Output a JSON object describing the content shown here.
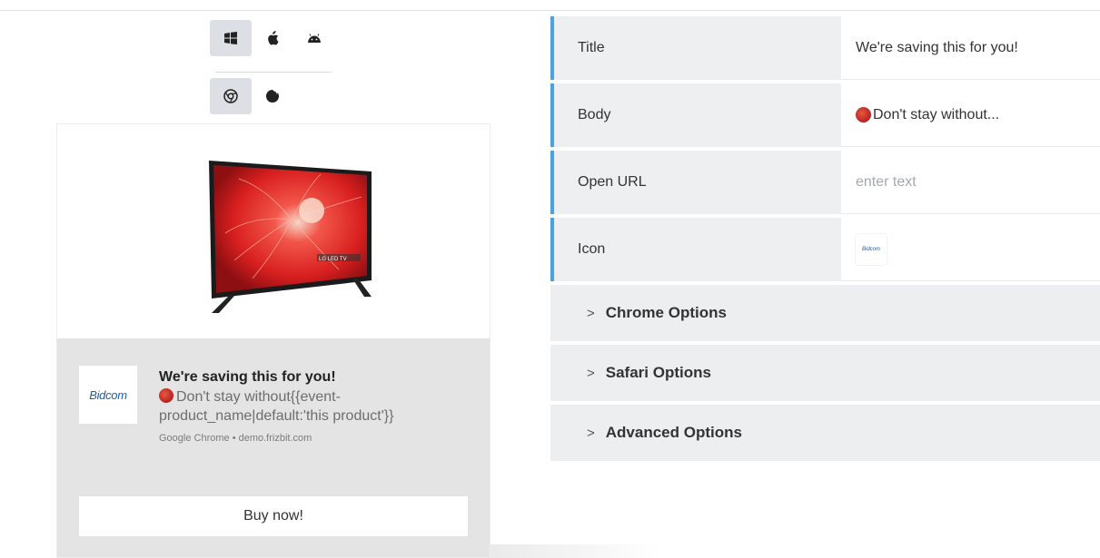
{
  "platforms": {
    "os": [
      {
        "name": "windows-icon",
        "active": true
      },
      {
        "name": "apple-icon",
        "active": false
      },
      {
        "name": "android-icon",
        "active": false
      }
    ],
    "browsers": [
      {
        "name": "chrome-icon",
        "active": true
      },
      {
        "name": "firefox-icon",
        "active": false
      }
    ]
  },
  "preview": {
    "image": "lg-led-tv-product-image",
    "image_label": "LG LED TV",
    "icon_logo": "Bidcom",
    "title": "We're saving this for you!",
    "body": "Don't stay without{{event-product_name|default:'this product'}}",
    "source": "Google Chrome • demo.frizbit.com",
    "button_label": "Buy now!"
  },
  "form": {
    "fields": [
      {
        "label": "Title",
        "value": "We're saving this for you!",
        "placeholder": ""
      },
      {
        "label": "Body",
        "value": "Don't stay without...",
        "placeholder": ""
      },
      {
        "label": "Open URL",
        "value": "",
        "placeholder": "enter text"
      },
      {
        "label": "Icon",
        "value": "Bidcom",
        "placeholder": ""
      }
    ],
    "sections": [
      {
        "label": "Chrome Options"
      },
      {
        "label": "Safari Options"
      },
      {
        "label": "Advanced Options"
      }
    ]
  },
  "colors": {
    "accent": "#4aa3e0",
    "active_button_bg": "#dcdfe3",
    "preview_bg": "#e4e4e4",
    "label_bg": "#edeff1"
  }
}
